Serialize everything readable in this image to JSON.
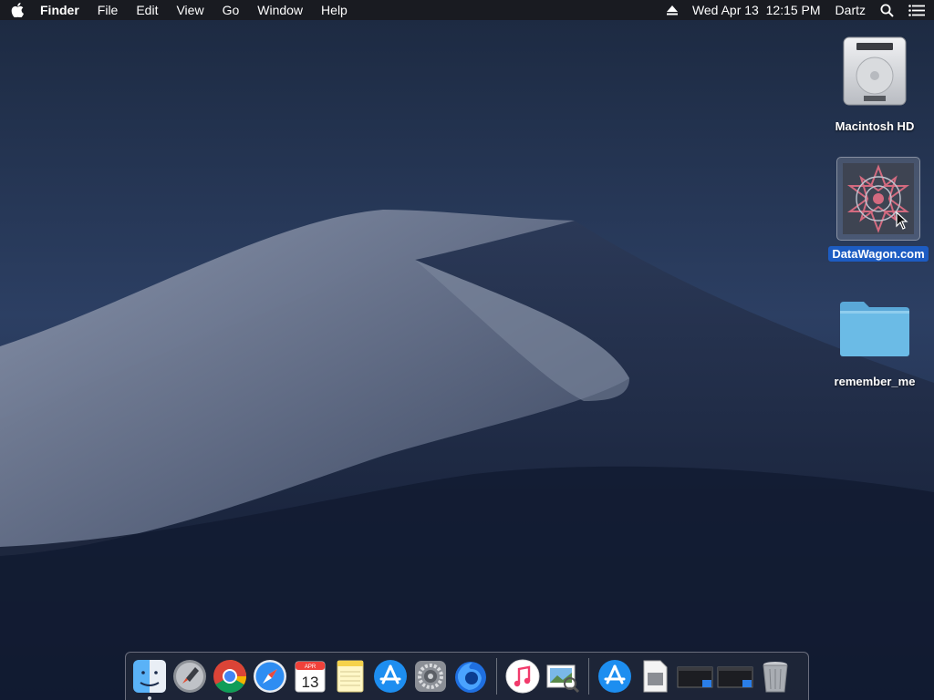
{
  "menubar": {
    "app_name": "Finder",
    "menus": [
      "File",
      "Edit",
      "View",
      "Go",
      "Window",
      "Help"
    ],
    "clock": "Wed Apr 13  12:15 PM",
    "user": "Dartz",
    "icons": [
      "apple-icon",
      "eject-icon",
      "spotlight-search-icon",
      "notification-center-icon"
    ]
  },
  "desktop": {
    "icons": [
      {
        "label": "Macintosh HD",
        "icon": "hard-drive-icon",
        "selected": false
      },
      {
        "label": "DataWagon.com",
        "icon": "disk-image-icon",
        "selected": true
      },
      {
        "label": "remember_me",
        "icon": "folder-icon",
        "selected": false
      }
    ]
  },
  "dock": {
    "apps": [
      {
        "name": "Finder",
        "icon": "finder-icon",
        "running": true
      },
      {
        "name": "Launchpad",
        "icon": "launchpad-icon",
        "running": false
      },
      {
        "name": "Google Chrome",
        "icon": "chrome-icon",
        "running": true
      },
      {
        "name": "Safari",
        "icon": "safari-icon",
        "running": false
      },
      {
        "name": "Calendar",
        "icon": "calendar-icon",
        "running": false,
        "month": "APR",
        "day": "13"
      },
      {
        "name": "Notes",
        "icon": "notes-icon",
        "running": false
      },
      {
        "name": "App Store",
        "icon": "app-store-icon",
        "running": false
      },
      {
        "name": "System Preferences",
        "icon": "system-preferences-icon",
        "running": false
      },
      {
        "name": "Firefox",
        "icon": "firefox-icon",
        "running": false
      },
      {
        "name": "iTunes",
        "icon": "itunes-icon",
        "running": false
      },
      {
        "name": "Preview",
        "icon": "preview-icon",
        "running": false
      }
    ],
    "others": [
      {
        "name": "App Store Downloads",
        "icon": "app-store-icon"
      },
      {
        "name": "Document",
        "icon": "document-icon"
      },
      {
        "name": "Screen Window 1",
        "icon": "window-thumbnail-icon"
      },
      {
        "name": "Screen Window 2",
        "icon": "window-thumbnail-icon"
      },
      {
        "name": "Trash",
        "icon": "trash-icon"
      }
    ]
  },
  "colors": {
    "menubar_bg": "#1a1b1f",
    "selection": "#1d5cc2",
    "sky": "#26385a",
    "dune": "#5d6880"
  }
}
